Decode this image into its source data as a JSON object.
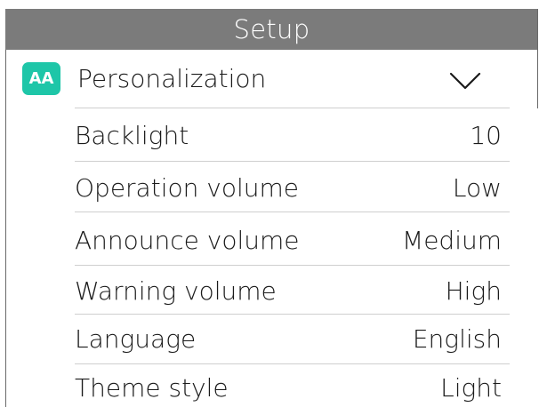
{
  "header": {
    "title": "Setup"
  },
  "section": {
    "icon_text": "AA",
    "icon_name": "text-size-icon",
    "label": "Personalization",
    "accent_color": "#1ec6a8",
    "expanded": true
  },
  "settings": [
    {
      "label": "Backlight",
      "value": "10"
    },
    {
      "label": "Operation volume",
      "value": "Low"
    },
    {
      "label": "Announce volume",
      "value": "Medium"
    },
    {
      "label": "Warning volume",
      "value": "High"
    },
    {
      "label": "Language",
      "value": "English"
    },
    {
      "label": "Theme style",
      "value": "Light"
    }
  ]
}
